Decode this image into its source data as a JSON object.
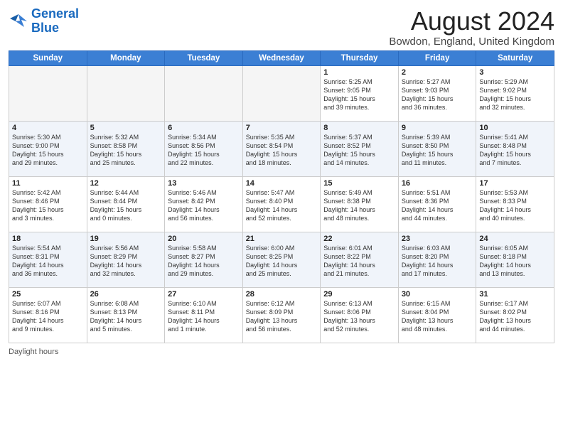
{
  "logo": {
    "line1": "General",
    "line2": "Blue"
  },
  "title": "August 2024",
  "subtitle": "Bowdon, England, United Kingdom",
  "columns": [
    "Sunday",
    "Monday",
    "Tuesday",
    "Wednesday",
    "Thursday",
    "Friday",
    "Saturday"
  ],
  "weeks": [
    [
      {
        "day": "",
        "info": "",
        "empty": true
      },
      {
        "day": "",
        "info": "",
        "empty": true
      },
      {
        "day": "",
        "info": "",
        "empty": true
      },
      {
        "day": "",
        "info": "",
        "empty": true
      },
      {
        "day": "1",
        "info": "Sunrise: 5:25 AM\nSunset: 9:05 PM\nDaylight: 15 hours\nand 39 minutes."
      },
      {
        "day": "2",
        "info": "Sunrise: 5:27 AM\nSunset: 9:03 PM\nDaylight: 15 hours\nand 36 minutes."
      },
      {
        "day": "3",
        "info": "Sunrise: 5:29 AM\nSunset: 9:02 PM\nDaylight: 15 hours\nand 32 minutes."
      }
    ],
    [
      {
        "day": "4",
        "info": "Sunrise: 5:30 AM\nSunset: 9:00 PM\nDaylight: 15 hours\nand 29 minutes."
      },
      {
        "day": "5",
        "info": "Sunrise: 5:32 AM\nSunset: 8:58 PM\nDaylight: 15 hours\nand 25 minutes."
      },
      {
        "day": "6",
        "info": "Sunrise: 5:34 AM\nSunset: 8:56 PM\nDaylight: 15 hours\nand 22 minutes."
      },
      {
        "day": "7",
        "info": "Sunrise: 5:35 AM\nSunset: 8:54 PM\nDaylight: 15 hours\nand 18 minutes."
      },
      {
        "day": "8",
        "info": "Sunrise: 5:37 AM\nSunset: 8:52 PM\nDaylight: 15 hours\nand 14 minutes."
      },
      {
        "day": "9",
        "info": "Sunrise: 5:39 AM\nSunset: 8:50 PM\nDaylight: 15 hours\nand 11 minutes."
      },
      {
        "day": "10",
        "info": "Sunrise: 5:41 AM\nSunset: 8:48 PM\nDaylight: 15 hours\nand 7 minutes."
      }
    ],
    [
      {
        "day": "11",
        "info": "Sunrise: 5:42 AM\nSunset: 8:46 PM\nDaylight: 15 hours\nand 3 minutes."
      },
      {
        "day": "12",
        "info": "Sunrise: 5:44 AM\nSunset: 8:44 PM\nDaylight: 15 hours\nand 0 minutes."
      },
      {
        "day": "13",
        "info": "Sunrise: 5:46 AM\nSunset: 8:42 PM\nDaylight: 14 hours\nand 56 minutes."
      },
      {
        "day": "14",
        "info": "Sunrise: 5:47 AM\nSunset: 8:40 PM\nDaylight: 14 hours\nand 52 minutes."
      },
      {
        "day": "15",
        "info": "Sunrise: 5:49 AM\nSunset: 8:38 PM\nDaylight: 14 hours\nand 48 minutes."
      },
      {
        "day": "16",
        "info": "Sunrise: 5:51 AM\nSunset: 8:36 PM\nDaylight: 14 hours\nand 44 minutes."
      },
      {
        "day": "17",
        "info": "Sunrise: 5:53 AM\nSunset: 8:33 PM\nDaylight: 14 hours\nand 40 minutes."
      }
    ],
    [
      {
        "day": "18",
        "info": "Sunrise: 5:54 AM\nSunset: 8:31 PM\nDaylight: 14 hours\nand 36 minutes."
      },
      {
        "day": "19",
        "info": "Sunrise: 5:56 AM\nSunset: 8:29 PM\nDaylight: 14 hours\nand 32 minutes."
      },
      {
        "day": "20",
        "info": "Sunrise: 5:58 AM\nSunset: 8:27 PM\nDaylight: 14 hours\nand 29 minutes."
      },
      {
        "day": "21",
        "info": "Sunrise: 6:00 AM\nSunset: 8:25 PM\nDaylight: 14 hours\nand 25 minutes."
      },
      {
        "day": "22",
        "info": "Sunrise: 6:01 AM\nSunset: 8:22 PM\nDaylight: 14 hours\nand 21 minutes."
      },
      {
        "day": "23",
        "info": "Sunrise: 6:03 AM\nSunset: 8:20 PM\nDaylight: 14 hours\nand 17 minutes."
      },
      {
        "day": "24",
        "info": "Sunrise: 6:05 AM\nSunset: 8:18 PM\nDaylight: 14 hours\nand 13 minutes."
      }
    ],
    [
      {
        "day": "25",
        "info": "Sunrise: 6:07 AM\nSunset: 8:16 PM\nDaylight: 14 hours\nand 9 minutes."
      },
      {
        "day": "26",
        "info": "Sunrise: 6:08 AM\nSunset: 8:13 PM\nDaylight: 14 hours\nand 5 minutes."
      },
      {
        "day": "27",
        "info": "Sunrise: 6:10 AM\nSunset: 8:11 PM\nDaylight: 14 hours\nand 1 minute."
      },
      {
        "day": "28",
        "info": "Sunrise: 6:12 AM\nSunset: 8:09 PM\nDaylight: 13 hours\nand 56 minutes."
      },
      {
        "day": "29",
        "info": "Sunrise: 6:13 AM\nSunset: 8:06 PM\nDaylight: 13 hours\nand 52 minutes."
      },
      {
        "day": "30",
        "info": "Sunrise: 6:15 AM\nSunset: 8:04 PM\nDaylight: 13 hours\nand 48 minutes."
      },
      {
        "day": "31",
        "info": "Sunrise: 6:17 AM\nSunset: 8:02 PM\nDaylight: 13 hours\nand 44 minutes."
      }
    ]
  ],
  "footer": "Daylight hours"
}
